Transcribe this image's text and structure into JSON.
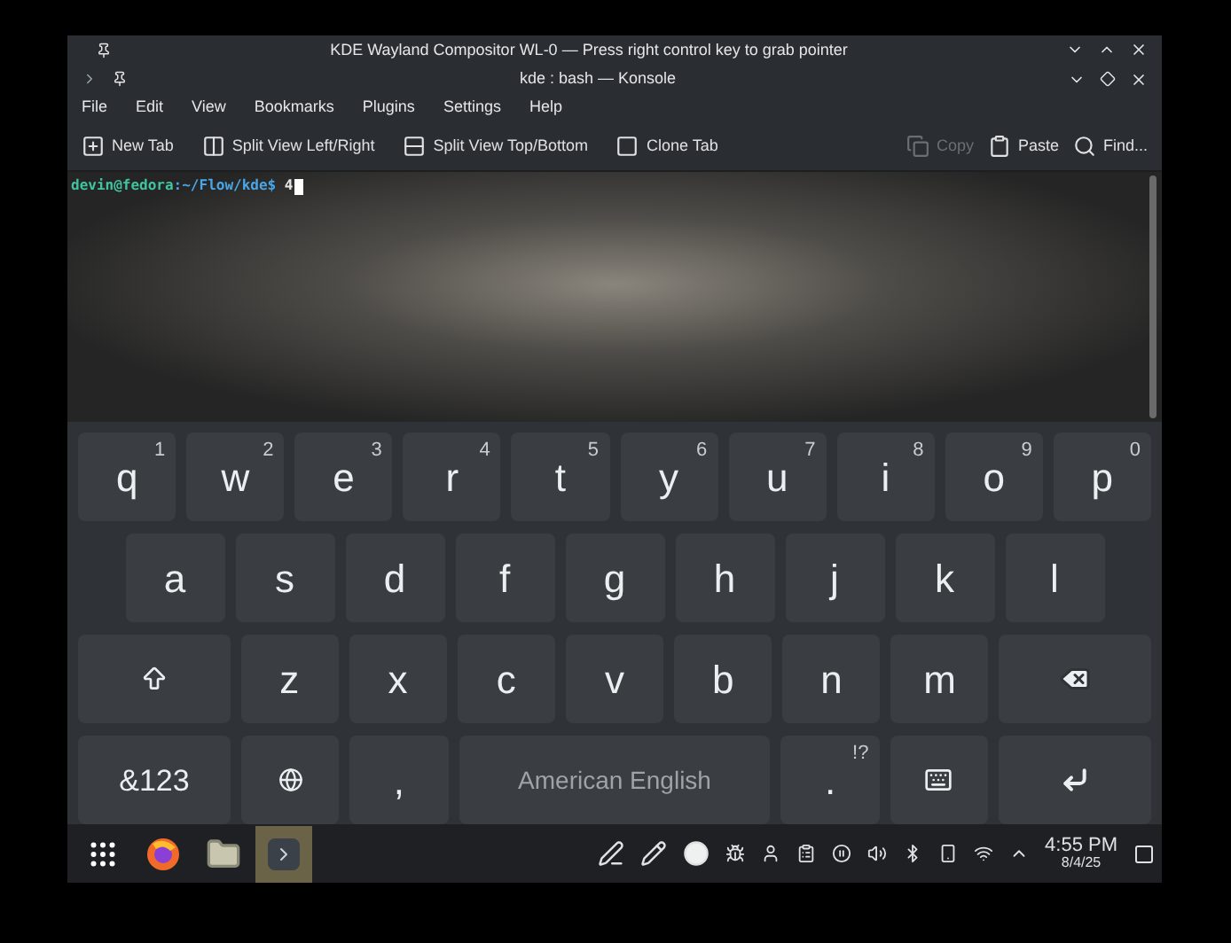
{
  "compositor": {
    "title": "KDE Wayland Compositor WL-0 — Press right control key to grab pointer"
  },
  "konsole": {
    "title": "kde : bash — Konsole",
    "menu": [
      "File",
      "Edit",
      "View",
      "Bookmarks",
      "Plugins",
      "Settings",
      "Help"
    ],
    "toolbar_left": [
      {
        "kind": "new-tab",
        "label": "New Tab",
        "disabled": false
      },
      {
        "kind": "split-lr",
        "label": "Split View Left/Right",
        "disabled": false
      },
      {
        "kind": "split-tb",
        "label": "Split View Top/Bottom",
        "disabled": false
      },
      {
        "kind": "clone",
        "label": "Clone Tab",
        "disabled": false
      }
    ],
    "toolbar_right": [
      {
        "kind": "copy",
        "label": "Copy",
        "disabled": true
      },
      {
        "kind": "paste",
        "label": "Paste",
        "disabled": false
      },
      {
        "kind": "find",
        "label": "Find...",
        "disabled": false
      }
    ],
    "terminal": {
      "user_host": "devin@fedora",
      "path": ":~/Flow/kde$",
      "input": "4"
    }
  },
  "keyboard": {
    "rows": [
      {
        "keys": [
          {
            "kind": "letter",
            "label": "q",
            "hint": "1"
          },
          {
            "kind": "letter",
            "label": "w",
            "hint": "2"
          },
          {
            "kind": "letter",
            "label": "e",
            "hint": "3"
          },
          {
            "kind": "letter",
            "label": "r",
            "hint": "4"
          },
          {
            "kind": "letter",
            "label": "t",
            "hint": "5"
          },
          {
            "kind": "letter",
            "label": "y",
            "hint": "6"
          },
          {
            "kind": "letter",
            "label": "u",
            "hint": "7"
          },
          {
            "kind": "letter",
            "label": "i",
            "hint": "8"
          },
          {
            "kind": "letter",
            "label": "o",
            "hint": "9"
          },
          {
            "kind": "letter",
            "label": "p",
            "hint": "0"
          }
        ]
      },
      {
        "keys": [
          {
            "kind": "letter",
            "label": "a"
          },
          {
            "kind": "letter",
            "label": "s"
          },
          {
            "kind": "letter",
            "label": "d"
          },
          {
            "kind": "letter",
            "label": "f"
          },
          {
            "kind": "letter",
            "label": "g"
          },
          {
            "kind": "letter",
            "label": "h"
          },
          {
            "kind": "letter",
            "label": "j"
          },
          {
            "kind": "letter",
            "label": "k"
          },
          {
            "kind": "letter",
            "label": "l"
          }
        ]
      },
      {
        "keys": [
          {
            "kind": "shift"
          },
          {
            "kind": "letter",
            "label": "z"
          },
          {
            "kind": "letter",
            "label": "x"
          },
          {
            "kind": "letter",
            "label": "c"
          },
          {
            "kind": "letter",
            "label": "v"
          },
          {
            "kind": "letter",
            "label": "b"
          },
          {
            "kind": "letter",
            "label": "n"
          },
          {
            "kind": "letter",
            "label": "m"
          },
          {
            "kind": "backspace"
          }
        ]
      },
      {
        "keys": [
          {
            "kind": "symbols",
            "label": "&123"
          },
          {
            "kind": "globe"
          },
          {
            "kind": "letter",
            "label": ","
          },
          {
            "kind": "space",
            "label": "American English"
          },
          {
            "kind": "letter",
            "label": ".",
            "hint": "!?"
          },
          {
            "kind": "hide"
          },
          {
            "kind": "enter"
          }
        ]
      }
    ]
  },
  "taskbar": {
    "tasks": [
      {
        "kind": "launcher",
        "selected": false
      },
      {
        "kind": "firefox",
        "selected": false
      },
      {
        "kind": "files",
        "selected": false
      },
      {
        "kind": "terminal",
        "selected": true
      }
    ],
    "time": "4:55 PM",
    "date": "8/4/25"
  }
}
